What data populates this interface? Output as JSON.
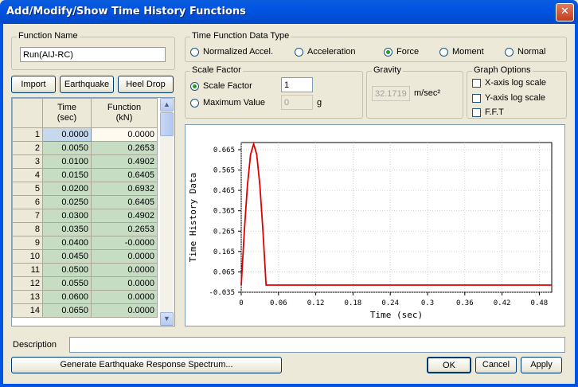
{
  "window": {
    "title": "Add/Modify/Show Time History Functions",
    "close_glyph": "✕"
  },
  "function_name": {
    "label": "Function Name",
    "value": "Run(AIJ-RC)"
  },
  "data_type": {
    "label": "Time Function Data Type",
    "options": [
      "Normalized Accel.",
      "Acceleration",
      "Force",
      "Moment",
      "Normal"
    ],
    "selected": "Force"
  },
  "scale": {
    "label": "Scale Factor",
    "scale_factor_label": "Scale Factor",
    "scale_factor_value": "1",
    "max_value_label": "Maximum Value",
    "max_value_value": "0",
    "max_value_unit": "g",
    "selected": "Scale Factor"
  },
  "gravity": {
    "label": "Gravity",
    "value": "32.1719",
    "unit": "m/sec²"
  },
  "graph_options": {
    "label": "Graph Options",
    "items": [
      "X-axis log scale",
      "Y-axis log scale",
      "F.F.T"
    ]
  },
  "toolbar": {
    "import": "Import",
    "earthquake": "Earthquake",
    "heel_drop": "Heel Drop"
  },
  "grid": {
    "col_time": "Time",
    "col_time_unit": "(sec)",
    "col_func": "Function",
    "col_func_unit": "(kN)",
    "rows": [
      [
        "1",
        "0.0000",
        "0.0000"
      ],
      [
        "2",
        "0.0050",
        "0.2653"
      ],
      [
        "3",
        "0.0100",
        "0.4902"
      ],
      [
        "4",
        "0.0150",
        "0.6405"
      ],
      [
        "5",
        "0.0200",
        "0.6932"
      ],
      [
        "6",
        "0.0250",
        "0.6405"
      ],
      [
        "7",
        "0.0300",
        "0.4902"
      ],
      [
        "8",
        "0.0350",
        "0.2653"
      ],
      [
        "9",
        "0.0400",
        "-0.0000"
      ],
      [
        "10",
        "0.0450",
        "0.0000"
      ],
      [
        "11",
        "0.0500",
        "0.0000"
      ],
      [
        "12",
        "0.0550",
        "0.0000"
      ],
      [
        "13",
        "0.0600",
        "0.0000"
      ],
      [
        "14",
        "0.0650",
        "0.0000"
      ]
    ]
  },
  "chart_data": {
    "type": "line",
    "xlabel": "Time (sec)",
    "ylabel": "Time History Data",
    "xlim": [
      0,
      0.5
    ],
    "ylim": [
      -0.035,
      0.7
    ],
    "x_ticks": [
      "0",
      "0.06",
      "0.12",
      "0.18",
      "0.24",
      "0.3",
      "0.36",
      "0.42",
      "0.48"
    ],
    "y_ticks": [
      "-0.035",
      "0.065",
      "0.165",
      "0.265",
      "0.365",
      "0.465",
      "0.565",
      "0.665"
    ],
    "grid": true,
    "color": "#dd0000",
    "series": [
      {
        "x": [
          0,
          0.005,
          0.01,
          0.015,
          0.02,
          0.025,
          0.03,
          0.035,
          0.04,
          0.045,
          0.05,
          0.1,
          0.2,
          0.3,
          0.4,
          0.5
        ],
        "y": [
          0,
          0.2653,
          0.4902,
          0.6405,
          0.6932,
          0.6405,
          0.4902,
          0.2653,
          0,
          0,
          0,
          0,
          0,
          0,
          0,
          0
        ]
      }
    ]
  },
  "description": {
    "label": "Description",
    "value": ""
  },
  "footer": {
    "generate": "Generate Earthquake Response Spectrum...",
    "ok": "OK",
    "cancel": "Cancel",
    "apply": "Apply"
  }
}
